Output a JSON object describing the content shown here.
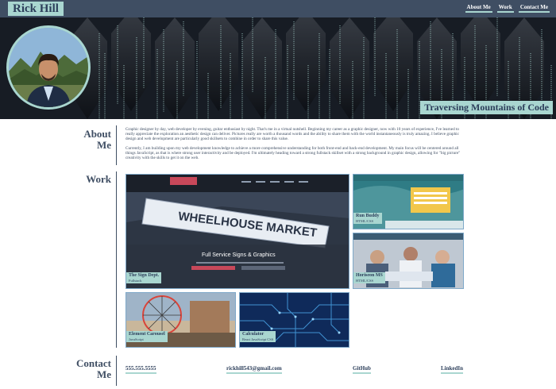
{
  "header": {
    "brand": "Rick Hill",
    "nav": [
      "About Me",
      "Work",
      "Contact Me"
    ]
  },
  "hero": {
    "tagline": "Traversing Mountains of Code"
  },
  "about": {
    "title_line1": "About",
    "title_line2": "Me",
    "paragraph1": "Graphic designer by day, web developer by evening, guitar enthusiast by night. That's me in a virtual nutshell. Beginning my career as a graphic designer, now with 10 years of experience, I've learned to really appreciate the exploration an aesthetic design can deliver. Pictures really are worth a thousand words and the ability to share them with the world instantaneously is truly amazing. I believe graphic design and web development are particularly good skillsets to combine in order to share this value.",
    "paragraph2": "Currently, I am building upon my web development knowledge to achieve a more comprehensive understanding for both front-end and back-end development. My main focus will be centered around all things JavaScript, as that is where strong user interactivity and be deployed. I'm ultimately heading toward a strong fullstack skillset with a strong background in graphic design, allowing for \"big picture\" creativity with the skills to get it on the web."
  },
  "work": {
    "title": "Work",
    "projects": [
      {
        "title": "The Sign Dept.",
        "tech": "Fullstack",
        "site_name": "WHEELHOUSE MARKET",
        "headline": "Full Service Signs & Graphics"
      },
      {
        "title": "Run Buddy",
        "tech": "HTML/CSS"
      },
      {
        "title": "Horiseon MS",
        "tech": "HTML/CSS"
      },
      {
        "title": "Element Carousel",
        "tech": "JavaScript"
      },
      {
        "title": "Calculator",
        "tech": "React JavaScript CSS"
      }
    ]
  },
  "contact": {
    "title_line1": "Contact",
    "title_line2": "Me",
    "phone": "555.555.5555",
    "email": "rickhill543@gmail.com",
    "github": "GitHub",
    "linkedin": "LinkedIn"
  },
  "colors": {
    "accent": "#a9d6d0",
    "primary": "#3f4e63",
    "hero_bg": "#171c24"
  }
}
